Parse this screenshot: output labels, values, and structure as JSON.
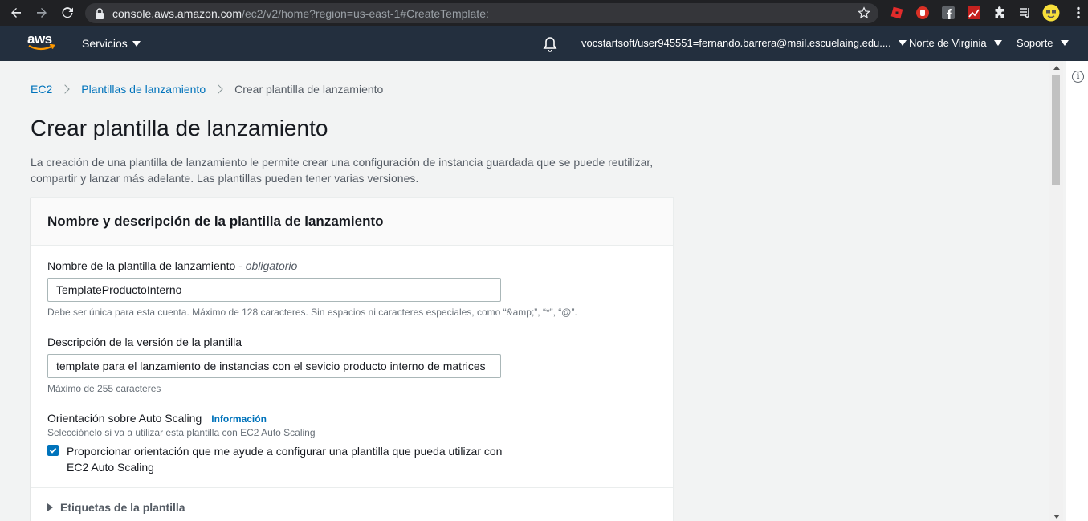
{
  "browser": {
    "url_host": "console.aws.amazon.com",
    "url_path": "/ec2/v2/home?region=us-east-1#CreateTemplate:"
  },
  "aws_nav": {
    "logo": "aws",
    "services": "Servicios",
    "account": "vocstartsoft/user945551=fernando.barrera@mail.escuelaing.edu....",
    "region": "Norte de Virginia",
    "support": "Soporte"
  },
  "breadcrumb": {
    "items": [
      "EC2",
      "Plantillas de lanzamiento"
    ],
    "current": "Crear plantilla de lanzamiento"
  },
  "page": {
    "title": "Crear plantilla de lanzamiento",
    "description": "La creación de una plantilla de lanzamiento le permite crear una configuración de instancia guardada que se puede reutilizar, compartir y lanzar más adelante. Las plantillas pueden tener varias versiones."
  },
  "panel": {
    "header": "Nombre y descripción de la plantilla de lanzamiento",
    "name_label": "Nombre de la plantilla de lanzamiento - ",
    "name_required": "obligatorio",
    "name_value": "TemplateProductoInterno",
    "name_hint": "Debe ser única para esta cuenta. Máximo de 128 caracteres. Sin espacios ni caracteres especiales, como “&amp;”, “*”, “@”.",
    "desc_label": "Descripción de la versión de la plantilla",
    "desc_value": "template para el lanzamiento de instancias con el sevicio producto interno de matrices",
    "desc_hint": "Máximo de 255 caracteres",
    "asg_label": "Orientación sobre Auto Scaling",
    "asg_info": "Información",
    "asg_hint": "Selecciónelo si va a utilizar esta plantilla con EC2 Auto Scaling",
    "asg_checkbox_label": "Proporcionar orientación que me ayude a configurar una plantilla que pueda utilizar con EC2 Auto Scaling",
    "asg_checked": true,
    "tags_expander": "Etiquetas de la plantilla"
  },
  "colors": {
    "aws_nav_bg": "#232f3e",
    "link": "#0073bb",
    "aws_orange": "#ff9900"
  }
}
